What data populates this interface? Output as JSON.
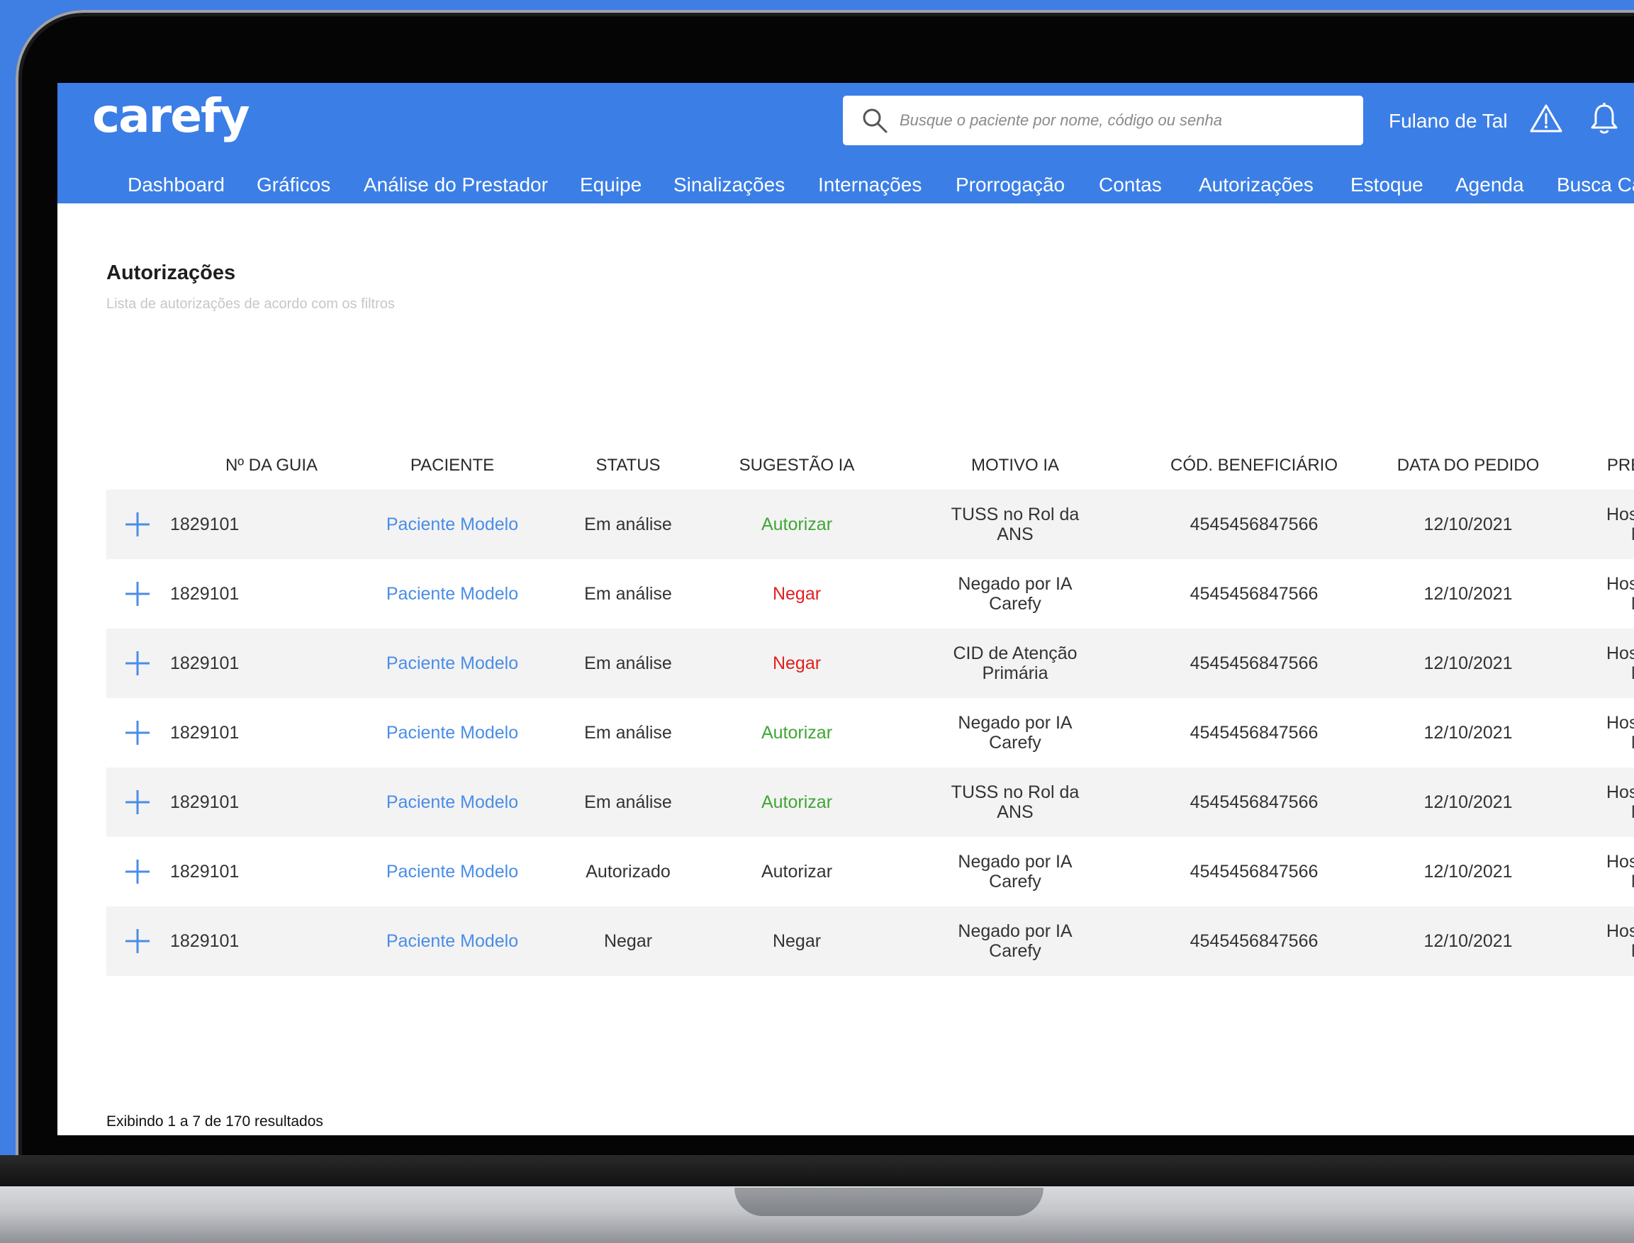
{
  "app": {
    "logo": "carefy",
    "search_placeholder": "Busque o paciente por nome, código ou senha",
    "user_name": "Fulano de Tal",
    "nav": [
      "Dashboard",
      "Gráficos",
      "Análise do Prestador",
      "Equipe",
      "Sinalizações",
      "Internações",
      "Prorrogação",
      "Contas",
      "Autorizações",
      "Estoque",
      "Agenda",
      "Busca Ca"
    ]
  },
  "page": {
    "title": "Autorizações",
    "subtitle": "Lista de autorizações de acordo com os filtros"
  },
  "table": {
    "headers": [
      "Nº DA GUIA",
      "PACIENTE",
      "STATUS",
      "SUGESTÃO IA",
      "MOTIVO IA",
      "CÓD. BENEFICIÁRIO",
      "DATA DO PEDIDO",
      "PRESTADO"
    ],
    "rows": [
      {
        "guia": "1829101",
        "paciente": "Paciente Modelo",
        "status": "Em análise",
        "sugestao": "Autorizar",
        "sugestao_color": "green",
        "motivo1": "TUSS no Rol da ANS",
        "motivo2": "",
        "cod": "4545456847566",
        "data": "12/10/2021",
        "prestador": "Hospital M"
      },
      {
        "guia": "1829101",
        "paciente": "Paciente Modelo",
        "status": "Em análise",
        "sugestao": "Negar",
        "sugestao_color": "red",
        "motivo1": "Negado por IA",
        "motivo2": "Carefy",
        "cod": "4545456847566",
        "data": "12/10/2021",
        "prestador": "Hospital M"
      },
      {
        "guia": "1829101",
        "paciente": "Paciente Modelo",
        "status": "Em análise",
        "sugestao": "Negar",
        "sugestao_color": "red",
        "motivo1": "CID de Atenção",
        "motivo2": "Primária",
        "cod": "4545456847566",
        "data": "12/10/2021",
        "prestador": "Hospital M"
      },
      {
        "guia": "1829101",
        "paciente": "Paciente Modelo",
        "status": "Em análise",
        "sugestao": "Autorizar",
        "sugestao_color": "green",
        "motivo1": "Negado por IA",
        "motivo2": "Carefy",
        "cod": "4545456847566",
        "data": "12/10/2021",
        "prestador": "Hospital M"
      },
      {
        "guia": "1829101",
        "paciente": "Paciente Modelo",
        "status": "Em análise",
        "sugestao": "Autorizar",
        "sugestao_color": "green",
        "motivo1": "TUSS no Rol da ANS",
        "motivo2": "",
        "cod": "4545456847566",
        "data": "12/10/2021",
        "prestador": "Hospital M"
      },
      {
        "guia": "1829101",
        "paciente": "Paciente Modelo",
        "status": "Autorizado",
        "sugestao": "Autorizar",
        "sugestao_color": "default",
        "motivo1": "Negado por IA",
        "motivo2": "Carefy",
        "cod": "4545456847566",
        "data": "12/10/2021",
        "prestador": "Hospital M"
      },
      {
        "guia": "1829101",
        "paciente": "Paciente Modelo",
        "status": "Negar",
        "sugestao": "Negar",
        "sugestao_color": "default",
        "motivo1": "Negado por IA",
        "motivo2": "Carefy",
        "cod": "4545456847566",
        "data": "12/10/2021",
        "prestador": "Hospital M"
      }
    ]
  },
  "results_text": "Exibindo 1 a 7 de 170 resultados",
  "colors": {
    "brand": "#3b7ee6",
    "link": "#4a8de6",
    "authorize": "#3fa634",
    "deny": "#e21f1f"
  }
}
